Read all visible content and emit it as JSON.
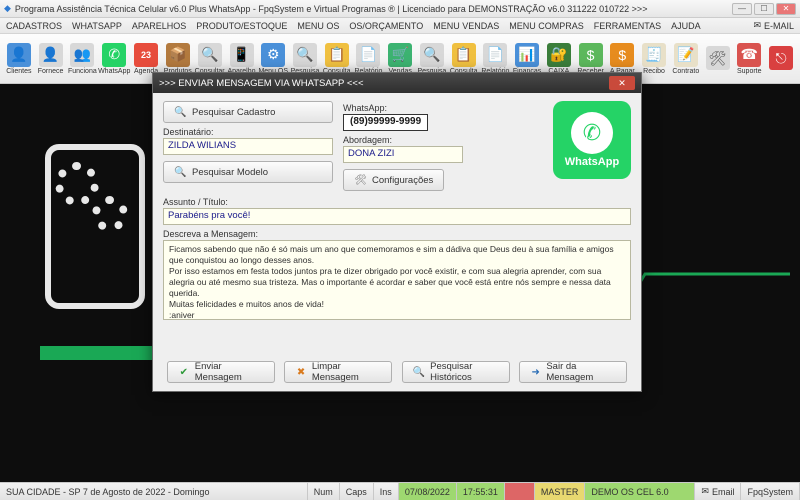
{
  "window": {
    "title": "Programa Assistência Técnica Celular v6.0 Plus WhatsApp - FpqSystem e Virtual Programas ® | Licenciado para  DEMONSTRAÇÃO v6.0 311222 010722 >>>"
  },
  "menu": {
    "items": [
      "CADASTROS",
      "WHATSAPP",
      "APARELHOS",
      "PRODUTO/ESTOQUE",
      "MENU OS",
      "OS/ORÇAMENTO",
      "MENU VENDAS",
      "MENU COMPRAS",
      "FERRAMENTAS",
      "AJUDA"
    ],
    "email": "E-MAIL"
  },
  "toolbar": {
    "items": [
      {
        "label": "Clientes"
      },
      {
        "label": "Fornece"
      },
      {
        "label": "Funciona"
      },
      {
        "label": "WhatsApp"
      },
      {
        "label": "Agenda",
        "badge": "23"
      },
      {
        "label": "Produtos"
      },
      {
        "label": "Consultar"
      },
      {
        "label": "Aparelho"
      },
      {
        "label": "Menu OS"
      },
      {
        "label": "Pesquisa"
      },
      {
        "label": "Consulta"
      },
      {
        "label": "Relatório"
      },
      {
        "label": "Vendas"
      },
      {
        "label": "Pesquisa"
      },
      {
        "label": "Consulta"
      },
      {
        "label": "Relatório"
      },
      {
        "label": "Finanças"
      },
      {
        "label": "CAIXA"
      },
      {
        "label": "Receber"
      },
      {
        "label": "A Pagar"
      },
      {
        "label": "Recibo"
      },
      {
        "label": "Contrato"
      },
      {
        "label": ""
      },
      {
        "label": "Suporte"
      },
      {
        "label": ""
      }
    ]
  },
  "dialog": {
    "title": ">>>  ENVIAR MENSAGEM VIA WHATSAPP  <<<",
    "btn_search_cad": "Pesquisar Cadastro",
    "btn_search_model": "Pesquisar Modelo",
    "btn_config": "Configurações",
    "lbl_whatsapp": "WhatsApp:",
    "whatsapp_number": "(89)99999-9999",
    "lbl_dest": "Destinatário:",
    "val_dest": "ZILDA WILIANS",
    "lbl_abord": "Abordagem:",
    "val_abord": "DONA ZIZI",
    "lbl_subject": "Assunto / Título:",
    "val_subject": "Parabéns pra você!",
    "lbl_msg": "Descreva a Mensagem:",
    "val_msg": "Ficamos sabendo que não é só mais um ano que comemoramos e sim a dádiva que Deus deu à sua família e amigos que conquistou ao longo desses anos.\nPor isso estamos em festa todos juntos pra te dizer obrigado por você existir, e com sua alegria aprender, com sua alegria ou até mesmo sua tristeza. Mas o importante é acordar e saber que você está entre nós sempre e nessa data querida.\nMuitas felicidades e muitos anos de vida!\n:aniver",
    "wapp_brand": "WhatsApp",
    "btn_send": "Enviar Mensagem",
    "btn_clear": "Limpar Mensagem",
    "btn_hist": "Pesquisar Históricos",
    "btn_exit": "Sair da Mensagem"
  },
  "status": {
    "location": "SUA CIDADE - SP  7 de Agosto de 2022 - Domingo",
    "num": "Num",
    "caps": "Caps",
    "ins": "Ins",
    "date": "07/08/2022",
    "time": "17:55:31",
    "master": "MASTER",
    "demo": "DEMO OS CEL 6.0",
    "email": "Email",
    "brand": "FpqSystem"
  }
}
